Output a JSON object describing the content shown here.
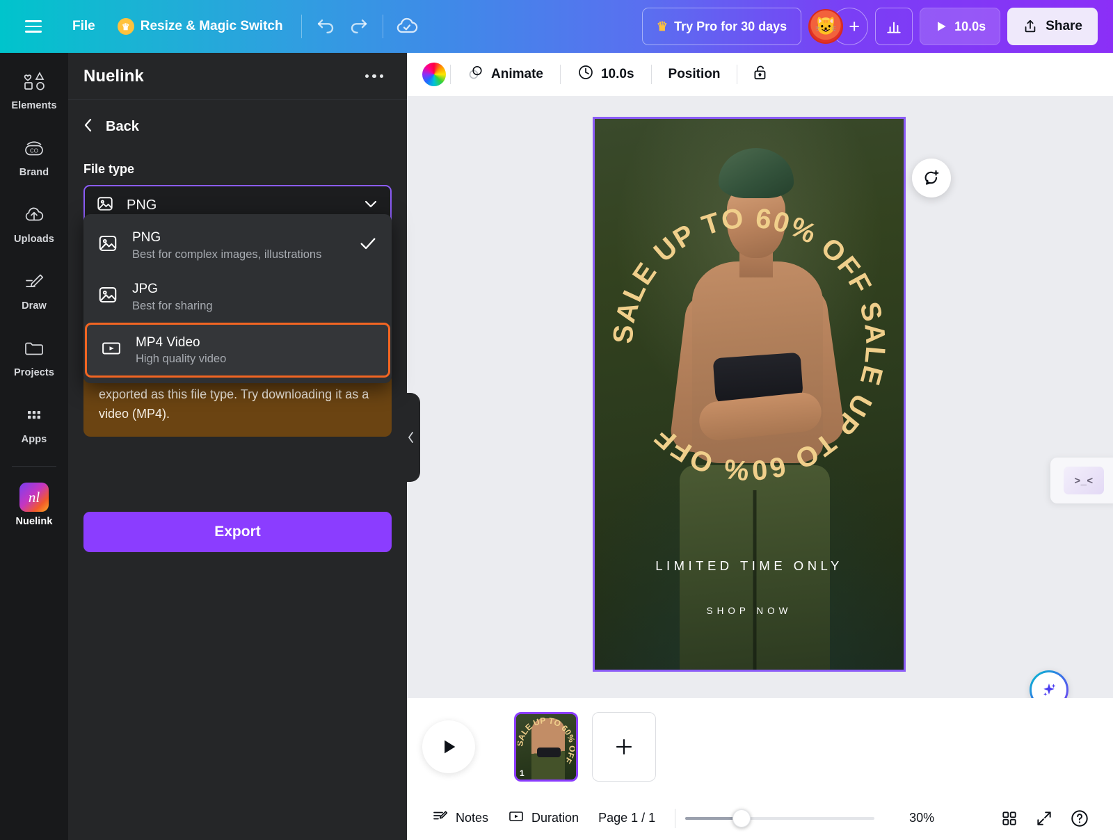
{
  "topbar": {
    "menu_icon": "hamburger-icon",
    "file_label": "File",
    "resize_label": "Resize & Magic Switch",
    "crown_icon": "crown-icon",
    "undo_icon": "undo-icon",
    "redo_icon": "redo-icon",
    "cloud_icon": "cloud-saved-icon",
    "try_pro_label": "Try Pro for 30 days",
    "avatar_icon": "user-avatar",
    "add_collaborator_icon": "plus-icon",
    "analytics_icon": "bar-chart-icon",
    "play_label": "10.0s",
    "play_icon": "play-icon",
    "share_label": "Share",
    "share_icon": "share-upload-icon"
  },
  "rail": {
    "items": [
      {
        "label": "Elements",
        "icon": "shapes-icon"
      },
      {
        "label": "Brand",
        "icon": "brand-icon"
      },
      {
        "label": "Uploads",
        "icon": "upload-cloud-icon"
      },
      {
        "label": "Draw",
        "icon": "pen-icon"
      },
      {
        "label": "Projects",
        "icon": "folder-icon"
      },
      {
        "label": "Apps",
        "icon": "grid-apps-icon"
      }
    ],
    "active_app": {
      "label": "Nuelink",
      "icon": "nuelink-logo",
      "mark": "nl"
    }
  },
  "panel": {
    "title": "Nuelink",
    "more_icon": "more-options-icon",
    "back_label": "Back",
    "back_icon": "chevron-left-icon",
    "file_type_label": "File type",
    "selected": {
      "value": "PNG",
      "icon": "image-file-icon",
      "chevron": "chevron-down-icon"
    },
    "options": [
      {
        "title": "PNG",
        "subtitle": "Best for complex images, illustrations",
        "icon": "image-file-icon",
        "checked": true,
        "highlighted": false
      },
      {
        "title": "JPG",
        "subtitle": "Best for sharing",
        "icon": "image-file-icon",
        "checked": false,
        "highlighted": false
      },
      {
        "title": "MP4 Video",
        "subtitle": "High quality video",
        "icon": "video-file-icon",
        "checked": false,
        "highlighted": true
      }
    ],
    "warning_text": "exported as this file type. Try downloading it as a video (MP4).",
    "export_label": "Export",
    "collapse_icon": "chevron-left-icon",
    "highlight_color": "#f26522",
    "accent_color": "#8b3dff"
  },
  "context_bar": {
    "color_icon": "color-wheel-icon",
    "animate_label": "Animate",
    "animate_icon": "animate-icon",
    "duration_label": "10.0s",
    "duration_icon": "clock-icon",
    "position_label": "Position",
    "lock_icon": "unlock-icon"
  },
  "canvas": {
    "design": {
      "ring_text": "SALE UP TO 60% OFF SALE UP TO 60% OFF ",
      "headline": "LIMITED TIME ONLY",
      "cta": "SHOP NOW",
      "ring_color": "#f0cf8b",
      "background_color": "#2b3a24"
    },
    "comment_icon": "add-comment-icon",
    "magic_icon": "magic-sparkle-icon",
    "side_panel_peek": ">_<",
    "collapse_icon": "chevron-down-icon"
  },
  "pagestrip": {
    "play_icon": "play-icon",
    "page_number": "1",
    "add_page_icon": "plus-icon",
    "thumb_ring_text": "SALE UP TO 60% OFF "
  },
  "bottombar": {
    "notes_label": "Notes",
    "notes_icon": "notes-icon",
    "duration_label": "Duration",
    "duration_icon": "duration-icon",
    "page_label": "Page 1 / 1",
    "zoom_value": "30%",
    "grid_icon": "grid-view-icon",
    "fullscreen_icon": "expand-icon",
    "help_icon": "help-circle-icon"
  }
}
